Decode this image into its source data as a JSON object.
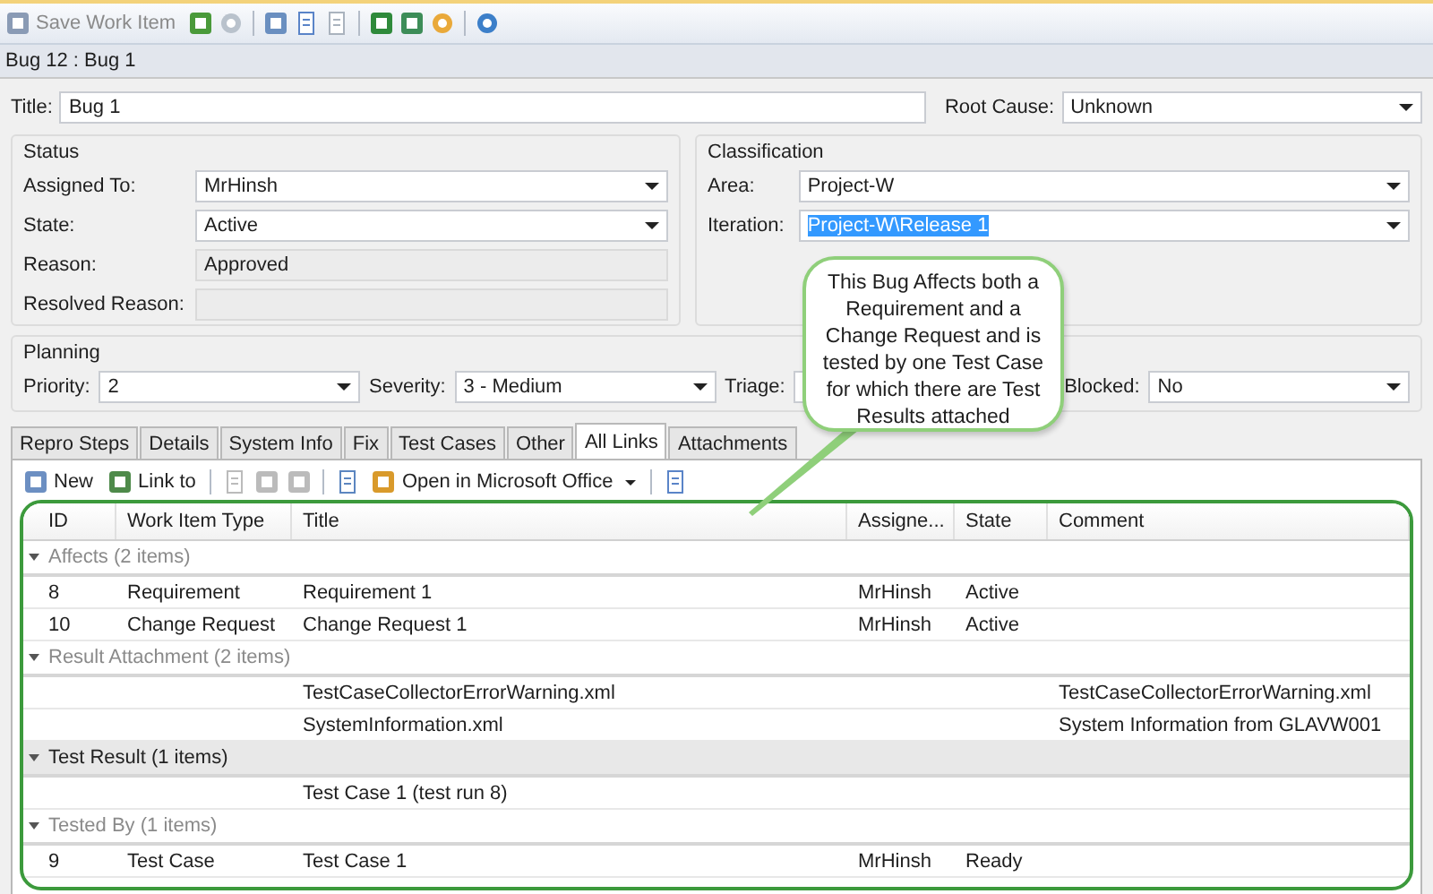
{
  "toolbar": {
    "save_label": "Save Work Item"
  },
  "header": {
    "title": "Bug 12 : Bug 1"
  },
  "title_row": {
    "title_label": "Title:",
    "title_value": "Bug 1",
    "root_label": "Root Cause:",
    "root_value": "Unknown"
  },
  "status": {
    "heading": "Status",
    "fields": [
      {
        "label": "Assigned To:",
        "value": "MrHinsh",
        "kind": "dropdown"
      },
      {
        "label": "State:",
        "value": "Active",
        "kind": "dropdown"
      },
      {
        "label": "Reason:",
        "value": "Approved",
        "kind": "readonly"
      },
      {
        "label": "Resolved Reason:",
        "kind": "readonly"
      }
    ]
  },
  "classification": {
    "heading": "Classification",
    "fields": [
      {
        "label": "Area:",
        "value": "Project-W",
        "kind": "dropdown",
        "highlighted": false
      },
      {
        "label": "Iteration:",
        "value": "Project-W\\Release 1",
        "kind": "dropdown",
        "highlighted": true
      }
    ]
  },
  "planning": {
    "heading": "Planning",
    "fields": [
      {
        "label": "Priority:",
        "value": "2",
        "kind": "dropdown"
      },
      {
        "label": "Severity:",
        "value": "3 - Medium",
        "kind": "dropdown"
      },
      {
        "label": "Triage:",
        "kind": "dropdown"
      },
      {
        "label": "Blocked:",
        "value": "No",
        "kind": "dropdown"
      }
    ]
  },
  "tabs": [
    {
      "label": "Repro Steps",
      "selected": false
    },
    {
      "label": "Details",
      "selected": false
    },
    {
      "label": "System Info",
      "selected": false
    },
    {
      "label": "Fix",
      "selected": false
    },
    {
      "label": "Test Cases",
      "selected": false
    },
    {
      "label": "Other",
      "selected": false
    },
    {
      "label": "All Links",
      "selected": true
    },
    {
      "label": "Attachments",
      "selected": false
    }
  ],
  "links_toolbar": {
    "new_label": "New",
    "link_label": "Link to",
    "office_label": "Open in Microsoft Office"
  },
  "table": {
    "columns": [
      "ID",
      "Work Item Type",
      "Title",
      "Assigne...",
      "State",
      "Comment"
    ],
    "groups": [
      {
        "label": "Affects (2 items)",
        "selected": false,
        "rows": [
          [
            "8",
            "Requirement",
            "Requirement 1",
            "MrHinsh",
            "Active",
            ""
          ],
          [
            "10",
            "Change Request",
            "Change Request 1",
            "MrHinsh",
            "Active",
            ""
          ]
        ]
      },
      {
        "label": "Result Attachment (2 items)",
        "selected": false,
        "rows": [
          [
            "",
            "",
            "TestCaseCollectorErrorWarning.xml",
            "",
            "",
            "TestCaseCollectorErrorWarning.xml"
          ],
          [
            "",
            "",
            "SystemInformation.xml",
            "",
            "",
            "System Information from GLAVW001"
          ]
        ]
      },
      {
        "label": "Test Result (1 items)",
        "selected": true,
        "rows": [
          [
            "",
            "",
            "Test Case 1 (test run 8)",
            "",
            "",
            ""
          ]
        ]
      },
      {
        "label": "Tested By (1 items)",
        "selected": false,
        "rows": [
          [
            "9",
            "Test Case",
            "Test Case 1",
            "MrHinsh",
            "Ready",
            ""
          ]
        ]
      }
    ]
  },
  "callout": {
    "text": "This Bug Affects both a Requirement and a Change Request and is tested by one Test Case for which there are Test Results attached"
  }
}
